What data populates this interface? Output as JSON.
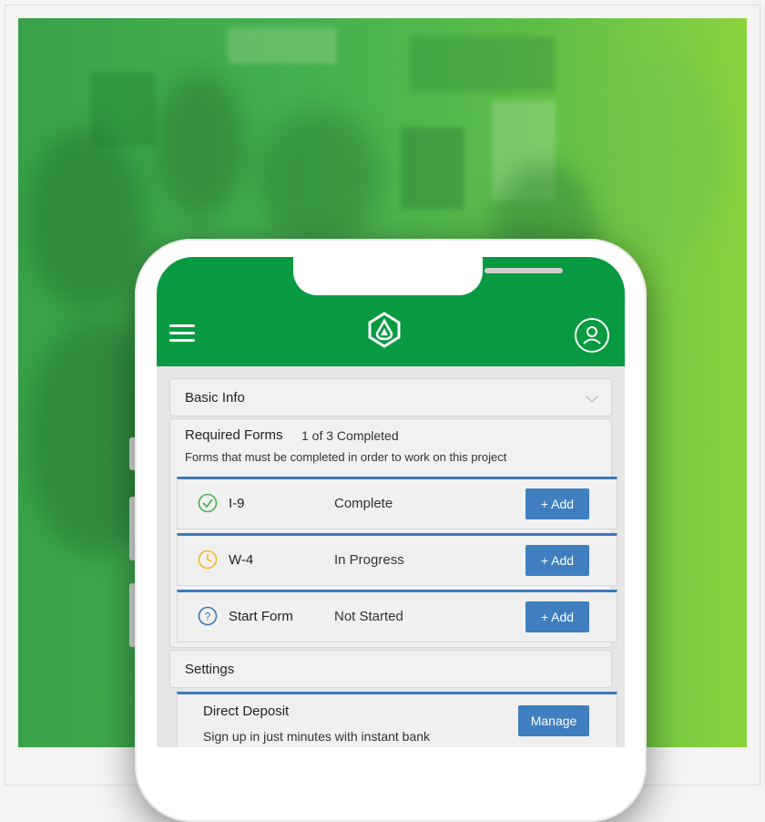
{
  "header": {
    "menu_icon": "hamburger-menu-icon",
    "logo_icon": "flame-shield-logo-icon",
    "user_icon": "user-avatar-icon"
  },
  "basic_info": {
    "label": "Basic Info",
    "icon": "chevron-down-icon"
  },
  "required_forms": {
    "title": "Required Forms",
    "progress": "1 of 3 Completed",
    "description": "Forms that must be completed in order to work on this project"
  },
  "forms": [
    {
      "name": "I-9",
      "status": "Complete",
      "icon": "check-circle-icon",
      "button": "+ Add"
    },
    {
      "name": "W-4",
      "status": "In Progress",
      "icon": "clock-icon",
      "button": "+ Add"
    },
    {
      "name": "Start Form",
      "status": "Not Started",
      "icon": "question-circle-icon",
      "button": "+ Add"
    }
  ],
  "settings": {
    "label": "Settings",
    "direct_deposit": {
      "title": "Direct Deposit",
      "description": "Sign up in just minutes with instant bank",
      "button": "Manage"
    }
  },
  "colors": {
    "brand_green": "#079a41",
    "button_blue": "#3f7fc0",
    "complete_green": "#4caf50",
    "progress_yellow": "#f3b71c",
    "not_started_blue": "#3d79b8"
  }
}
